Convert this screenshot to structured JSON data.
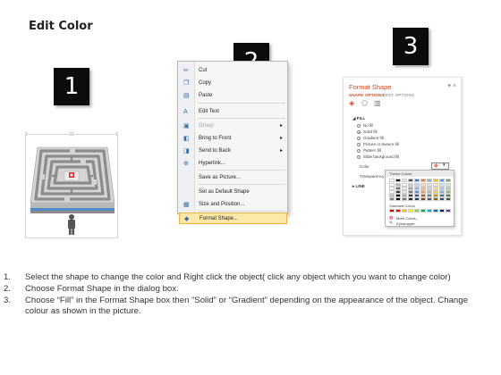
{
  "title": "Edit Color",
  "step_boxes": [
    "1",
    "2",
    "3"
  ],
  "context_menu": {
    "items": [
      {
        "label": "Cut",
        "icon": "scissors-icon",
        "glyph": "✂",
        "submenu": false,
        "disabled": false,
        "highlighted": false
      },
      {
        "label": "Copy",
        "icon": "copy-icon",
        "glyph": "❐",
        "submenu": false,
        "disabled": false,
        "highlighted": false
      },
      {
        "label": "Paste",
        "icon": "paste-icon",
        "glyph": "▤",
        "submenu": false,
        "disabled": false,
        "highlighted": false
      },
      {
        "label": "Edit Text",
        "icon": "edit-text-icon",
        "glyph": "A",
        "submenu": false,
        "disabled": false,
        "highlighted": false
      },
      {
        "label": "Group",
        "icon": "group-icon",
        "glyph": "▣",
        "submenu": true,
        "disabled": true,
        "highlighted": false
      },
      {
        "label": "Bring to Front",
        "icon": "bring-to-front-icon",
        "glyph": "◧",
        "submenu": true,
        "disabled": false,
        "highlighted": false
      },
      {
        "label": "Send to Back",
        "icon": "send-to-back-icon",
        "glyph": "◨",
        "submenu": true,
        "disabled": false,
        "highlighted": false
      },
      {
        "label": "Hyperlink...",
        "icon": "hyperlink-icon",
        "glyph": "⊕",
        "submenu": false,
        "disabled": false,
        "highlighted": false
      },
      {
        "label": "Save as Picture...",
        "icon": "",
        "glyph": "",
        "submenu": false,
        "disabled": false,
        "highlighted": false
      },
      {
        "label": "Set as Default Shape",
        "icon": "",
        "glyph": "",
        "submenu": false,
        "disabled": false,
        "highlighted": false
      },
      {
        "label": "Size and Position...",
        "icon": "size-position-icon",
        "glyph": "▦",
        "submenu": false,
        "disabled": false,
        "highlighted": false
      },
      {
        "label": "Format Shape...",
        "icon": "format-shape-icon",
        "glyph": "◆",
        "submenu": false,
        "disabled": false,
        "highlighted": true
      }
    ]
  },
  "format_pane": {
    "title": "Format Shape",
    "close_glyph": "▾ ×",
    "tabs": [
      "SHAPE OPTIONS",
      "TEXT OPTIONS"
    ],
    "fill_section": "FILL",
    "fill_options": [
      {
        "label": "No fill",
        "selected": false
      },
      {
        "label": "Solid fill",
        "selected": true
      },
      {
        "label": "Gradient fill",
        "selected": false
      },
      {
        "label": "Picture or texture fill",
        "selected": false
      },
      {
        "label": "Pattern fill",
        "selected": false
      },
      {
        "label": "Slide background fill",
        "selected": false
      }
    ],
    "color_label": "Color",
    "transparency_label": "Transparency",
    "line_section": "LINE"
  },
  "color_popup": {
    "theme_colors_label": "Theme Colors",
    "standard_colors_label": "Standard Colors",
    "more_colors_label": "More Colors...",
    "eyedropper_label": "Eyedropper",
    "theme_top": [
      "#ffffff",
      "#000000",
      "#e7e6e6",
      "#44546a",
      "#4472c4",
      "#ed7d31",
      "#a5a5a5",
      "#ffc000",
      "#5b9bd5",
      "#70ad47"
    ],
    "standard": [
      "#c00000",
      "#ff0000",
      "#ffc000",
      "#ffff00",
      "#92d050",
      "#00b050",
      "#00b0f0",
      "#0070c0",
      "#002060",
      "#7030a0"
    ]
  },
  "instructions": [
    {
      "n": "1.",
      "text": "Select the shape to change the color and Right click the object( click any object which you want to change color)"
    },
    {
      "n": "2.",
      "text": "Choose Format Shape in the dialog box."
    },
    {
      "n": "3.",
      "text": "Choose “Fill” in the Format Shape box then “Solid” or “Gradient” depending on the appearance of the object. Change colour as shown in the picture."
    }
  ]
}
